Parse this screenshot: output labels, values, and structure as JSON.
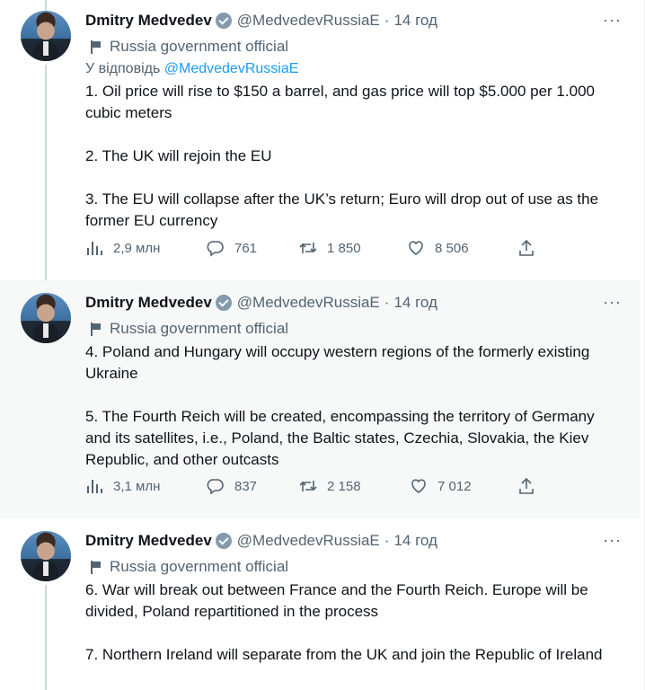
{
  "tweets": [
    {
      "name": "Dmitry Medvedev",
      "handle": "@MedvedevRussiaE",
      "dot": "·",
      "time": "14 год",
      "more": "···",
      "label": "Russia government official",
      "reply_prefix": "У відповідь",
      "reply_handle": "@MedvedevRussiaE",
      "text": "1.  Oil price will rise to $150 a barrel, and gas price will top $5.000 per 1.000 cubic meters\n\n2. The UK will rejoin the EU\n\n3. The EU will collapse after the UK’s return; Euro will drop out of use as the former EU currency",
      "views": "2,9 млн",
      "replies": "761",
      "retweets": "1 850",
      "likes": "8 506"
    },
    {
      "name": "Dmitry Medvedev",
      "handle": "@MedvedevRussiaE",
      "dot": "·",
      "time": "14 год",
      "more": "···",
      "label": "Russia government official",
      "text": "4. Poland and Hungary will occupy western regions of the formerly existing Ukraine\n\n5. The Fourth Reich will be created, encompassing the territory of Germany and its satellites, i.e., Poland, the Baltic states, Czechia, Slovakia, the Kiev Republic, and other outcasts",
      "views": "3,1 млн",
      "replies": "837",
      "retweets": "2 158",
      "likes": "7 012"
    },
    {
      "name": "Dmitry Medvedev",
      "handle": "@MedvedevRussiaE",
      "dot": "·",
      "time": "14 год",
      "more": "···",
      "label": "Russia government official",
      "text": "6. War will break out between France and the Fourth Reich. Europe will be divided, Poland repartitioned in the process\n\n7. Northern Ireland will separate from the UK and join the Republic of Ireland"
    }
  ],
  "icons": [
    "views-icon",
    "reply-icon",
    "retweet-icon",
    "like-icon",
    "share-icon",
    "flag-icon",
    "verified-badge-icon",
    "more-icon"
  ],
  "colors": {
    "link": "#1d9bf0",
    "muted": "#536471",
    "highlight_bg": "#f7f9f9"
  }
}
